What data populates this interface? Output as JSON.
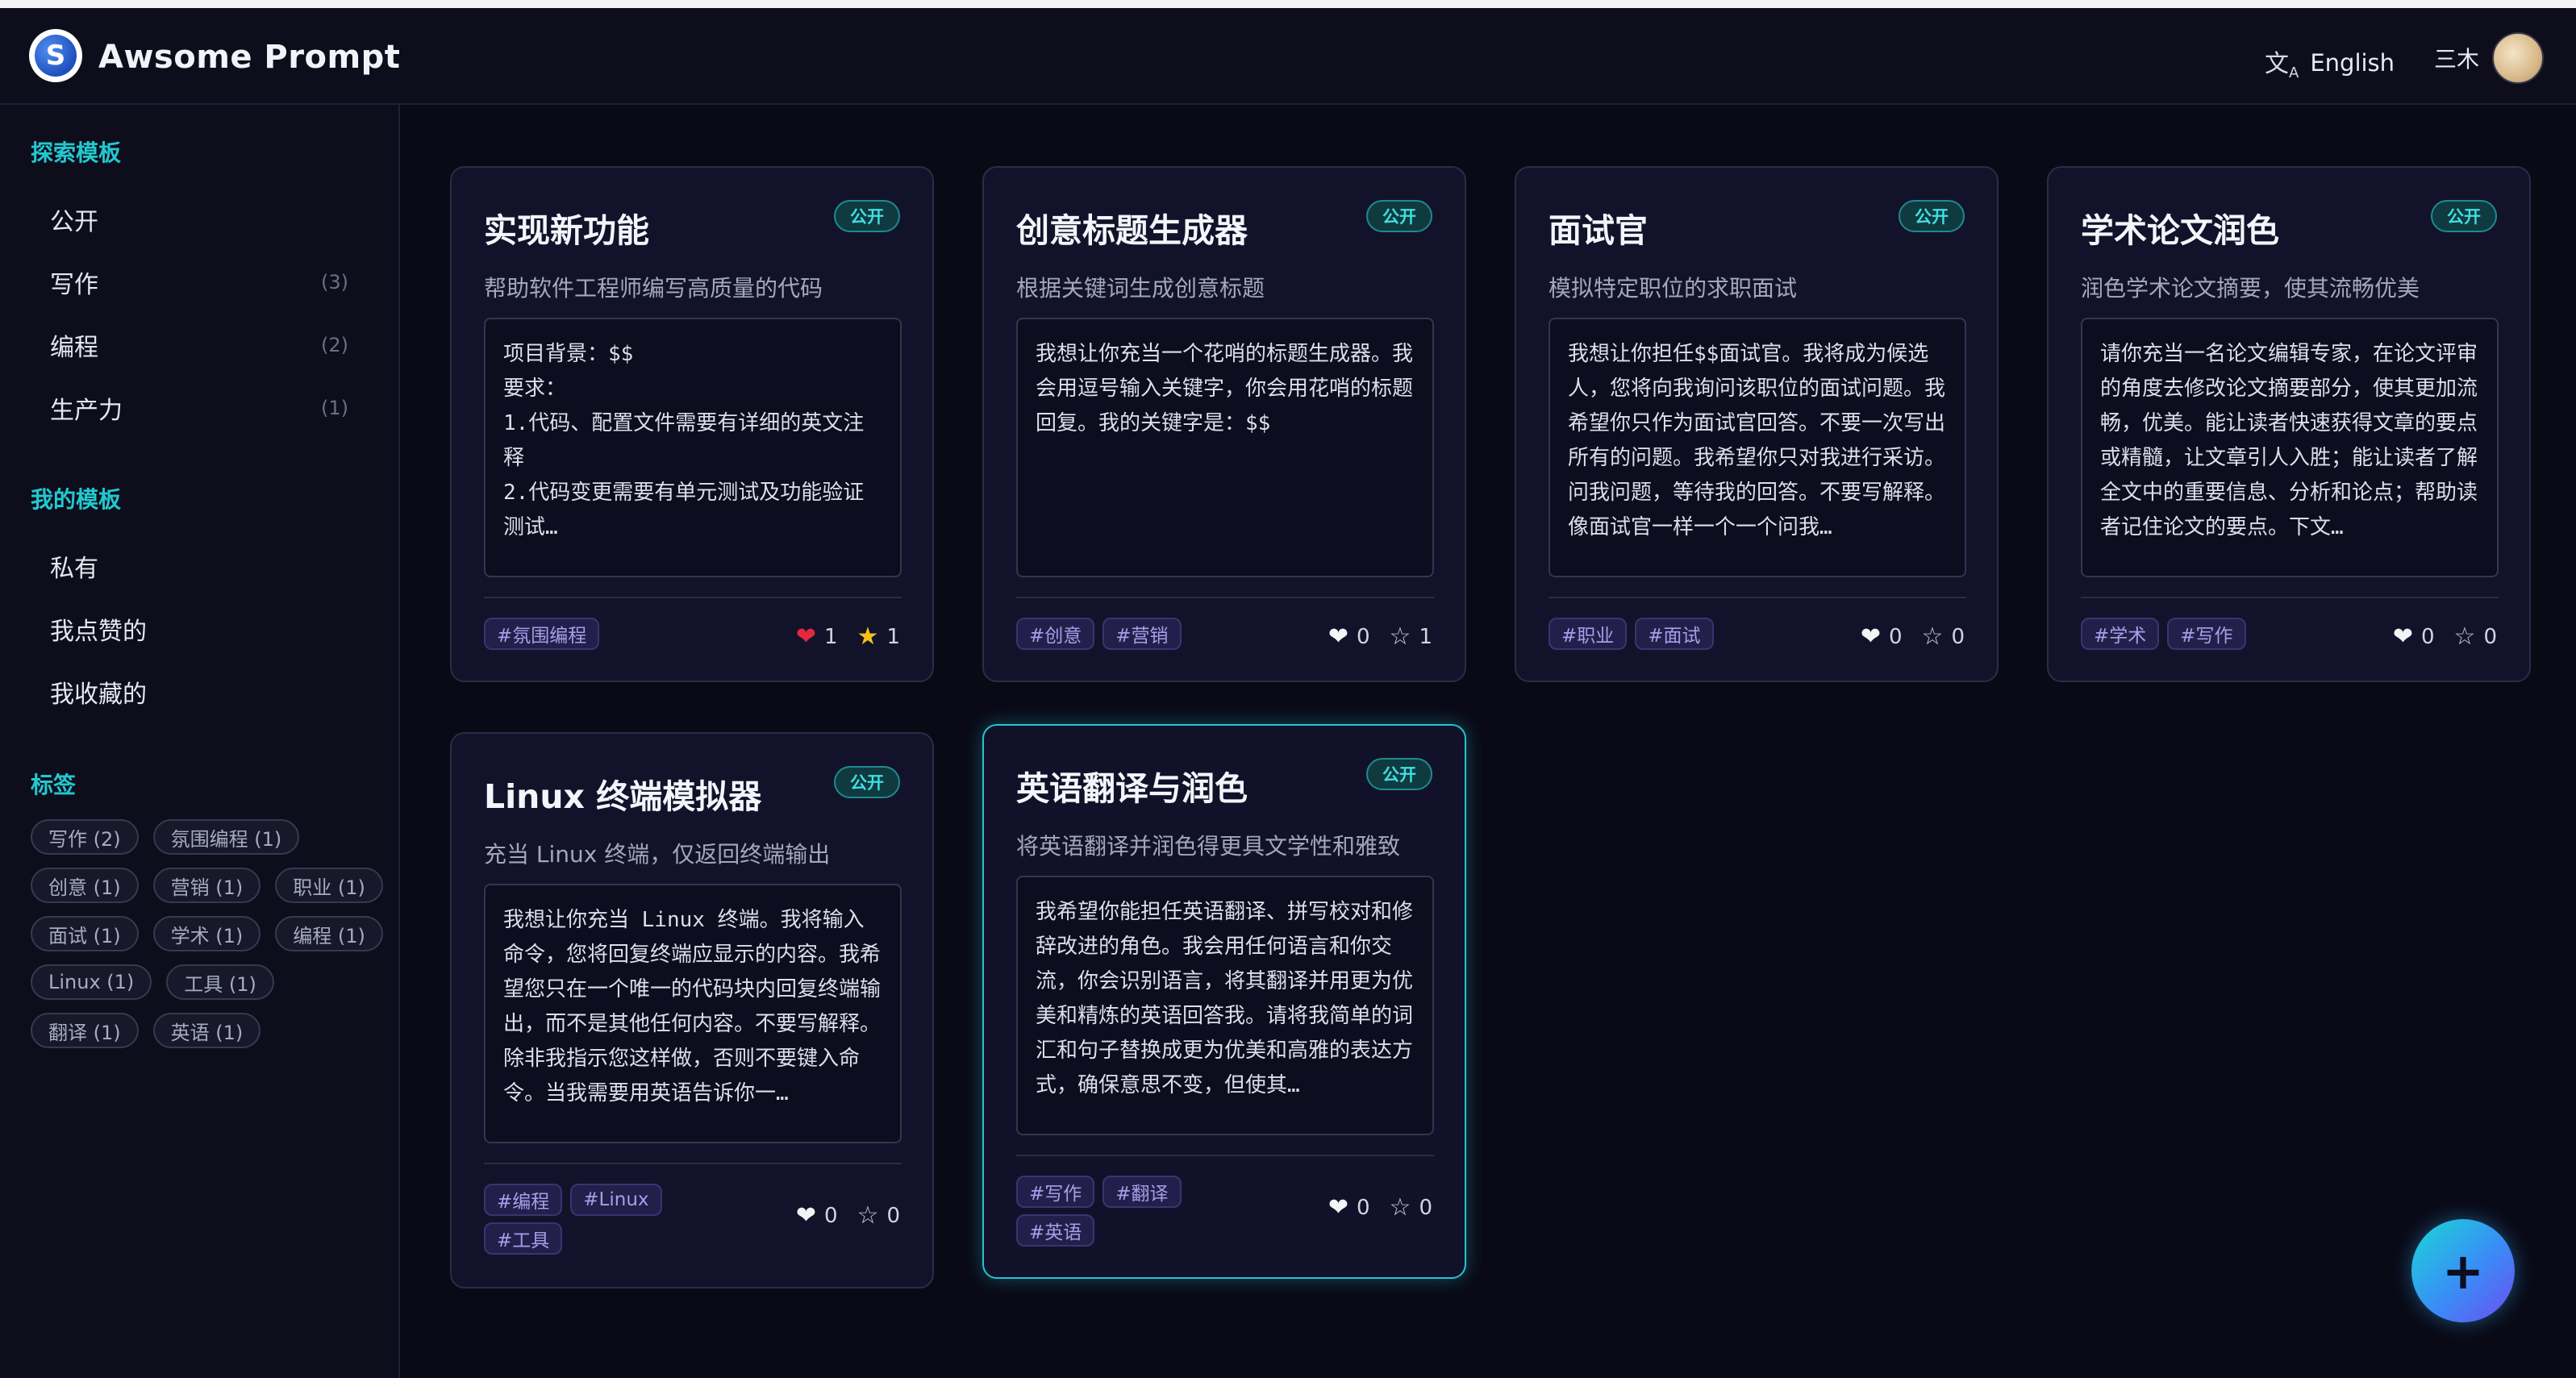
{
  "app": {
    "title": "Awsome Prompt",
    "logo_letter": "S"
  },
  "header": {
    "language_label": "English",
    "language_icon": "translate-icon",
    "user_name": "三木"
  },
  "sidebar": {
    "explore_title": "探索模板",
    "explore_items": [
      {
        "label": "公开",
        "count": ""
      },
      {
        "label": "写作",
        "count": "(3)"
      },
      {
        "label": "编程",
        "count": "(2)"
      },
      {
        "label": "生产力",
        "count": "(1)"
      }
    ],
    "mine_title": "我的模板",
    "mine_items": [
      {
        "label": "私有"
      },
      {
        "label": "我点赞的"
      },
      {
        "label": "我收藏的"
      }
    ],
    "tags_title": "标签",
    "tags": [
      "写作 (2)",
      "氛围编程 (1)",
      "创意 (1)",
      "营销 (1)",
      "职业 (1)",
      "面试 (1)",
      "学术 (1)",
      "编程 (1)",
      "Linux (1)",
      "工具 (1)",
      "翻译 (1)",
      "英语 (1)"
    ]
  },
  "cards": [
    {
      "title": "实现新功能",
      "badge": "公开",
      "desc": "帮助软件工程师编写高质量的代码",
      "prompt": "项目背景：$$\n要求：\n1.代码、配置文件需要有详细的英文注释\n2.代码变更需要有单元测试及功能验证测试…",
      "tags": [
        "#氛围编程"
      ],
      "likes": "1",
      "favs": "1",
      "liked": true,
      "faved": true
    },
    {
      "title": "创意标题生成器",
      "badge": "公开",
      "desc": "根据关键词生成创意标题",
      "prompt": "我想让你充当一个花哨的标题生成器。我会用逗号输入关键字，你会用花哨的标题回复。我的关键字是：$$",
      "tags": [
        "#创意",
        "#营销"
      ],
      "likes": "0",
      "favs": "1",
      "liked": false,
      "faved": false
    },
    {
      "title": "面试官",
      "badge": "公开",
      "desc": "模拟特定职位的求职面试",
      "prompt": "我想让你担任$$面试官。我将成为候选人，您将向我询问该职位的面试问题。我希望你只作为面试官回答。不要一次写出所有的问题。我希望你只对我进行采访。问我问题，等待我的回答。不要写解释。像面试官一样一个一个问我…",
      "tags": [
        "#职业",
        "#面试"
      ],
      "likes": "0",
      "favs": "0",
      "liked": false,
      "faved": false
    },
    {
      "title": "学术论文润色",
      "badge": "公开",
      "desc": "润色学术论文摘要，使其流畅优美",
      "prompt": "请你充当一名论文编辑专家，在论文评审的角度去修改论文摘要部分，使其更加流畅，优美。能让读者快速获得文章的要点或精髓，让文章引人入胜；能让读者了解全文中的重要信息、分析和论点；帮助读者记住论文的要点。下文…",
      "tags": [
        "#学术",
        "#写作"
      ],
      "likes": "0",
      "favs": "0",
      "liked": false,
      "faved": false
    },
    {
      "title": "Linux 终端模拟器",
      "badge": "公开",
      "desc": "充当 Linux 终端，仅返回终端输出",
      "prompt": "我想让你充当 Linux 终端。我将输入命令，您将回复终端应显示的内容。我希望您只在一个唯一的代码块内回复终端输出，而不是其他任何内容。不要写解释。除非我指示您这样做，否则不要键入命令。当我需要用英语告诉你一…",
      "tags": [
        "#编程",
        "#Linux",
        "#工具"
      ],
      "likes": "0",
      "favs": "0",
      "liked": false,
      "faved": false
    },
    {
      "title": "英语翻译与润色",
      "badge": "公开",
      "desc": "将英语翻译并润色得更具文学性和雅致",
      "prompt": "我希望你能担任英语翻译、拼写校对和修辞改进的角色。我会用任何语言和你交流，你会识别语言，将其翻译并用更为优美和精炼的英语回答我。请将我简单的词汇和句子替换成更为优美和高雅的表达方式，确保意思不变，但使其…",
      "tags": [
        "#写作",
        "#翻译",
        "#英语"
      ],
      "likes": "0",
      "favs": "0",
      "liked": false,
      "faved": false
    }
  ],
  "fab": {
    "label": "+"
  }
}
